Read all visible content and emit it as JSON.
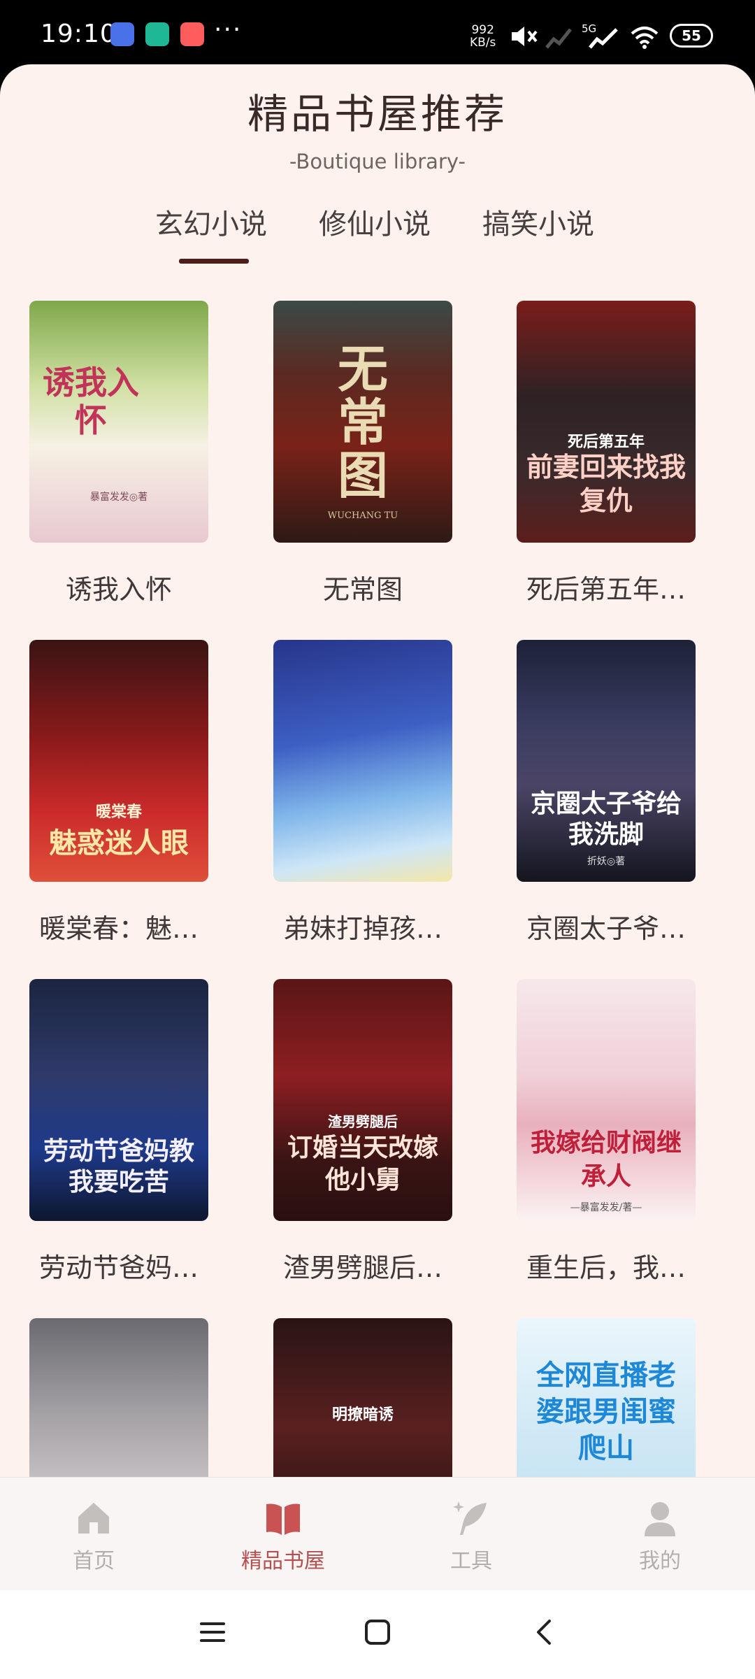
{
  "status_bar": {
    "time": "19:10",
    "more": "···",
    "net_speed_value": "992",
    "net_speed_unit": "KB/s",
    "network": "5G",
    "battery": "55"
  },
  "header": {
    "title": "精品书屋推荐",
    "subtitle": "-Boutique library-"
  },
  "tabs": [
    {
      "label": "玄幻小说",
      "active": true
    },
    {
      "label": "修仙小说",
      "active": false
    },
    {
      "label": "搞笑小说",
      "active": false
    }
  ],
  "books": [
    {
      "title": "诱我入怀",
      "cover_text": "诱我入怀",
      "cover_author": "暴富发发◎著"
    },
    {
      "title": "无常图",
      "cover_text": "无常图",
      "cover_author": "WUCHANG TU"
    },
    {
      "title": "死后第五年…",
      "cover_text": "前妻回来找我复仇",
      "cover_author": "死后第五年"
    },
    {
      "title": "暖棠春：魅…",
      "cover_text": "魅惑迷人眼",
      "cover_author": "暖棠春"
    },
    {
      "title": "弟妹打掉孩…",
      "cover_text": "",
      "cover_author": ""
    },
    {
      "title": "京圈太子爷…",
      "cover_text": "京圈太子爷给我洗脚",
      "cover_author": "折妖◎著"
    },
    {
      "title": "劳动节爸妈…",
      "cover_text": "劳动节爸妈教我要吃苦",
      "cover_author": ""
    },
    {
      "title": "渣男劈腿后…",
      "cover_text": "订婚当天改嫁他小舅",
      "cover_author": "渣男劈腿后"
    },
    {
      "title": "重生后，我…",
      "cover_text": "我嫁给财阀继承人",
      "cover_author": "—暴富发发/著—"
    },
    {
      "title": "",
      "cover_text": "",
      "cover_author": ""
    },
    {
      "title": "",
      "cover_text": "明撩暗诱",
      "cover_author": ""
    },
    {
      "title": "",
      "cover_text": "全网直播老婆跟男闺蜜爬山",
      "cover_author": ""
    }
  ],
  "bottom_nav": [
    {
      "label": "首页",
      "icon": "home-icon",
      "active": false
    },
    {
      "label": "精品书屋",
      "icon": "book-icon",
      "active": true
    },
    {
      "label": "工具",
      "icon": "feather-icon",
      "active": false
    },
    {
      "label": "我的",
      "icon": "user-icon",
      "active": false
    }
  ],
  "colors": {
    "background": "#fdf2ee",
    "accent": "#b55050",
    "tab_underline": "#4d1f1b",
    "inactive_nav": "#b2aeac"
  }
}
